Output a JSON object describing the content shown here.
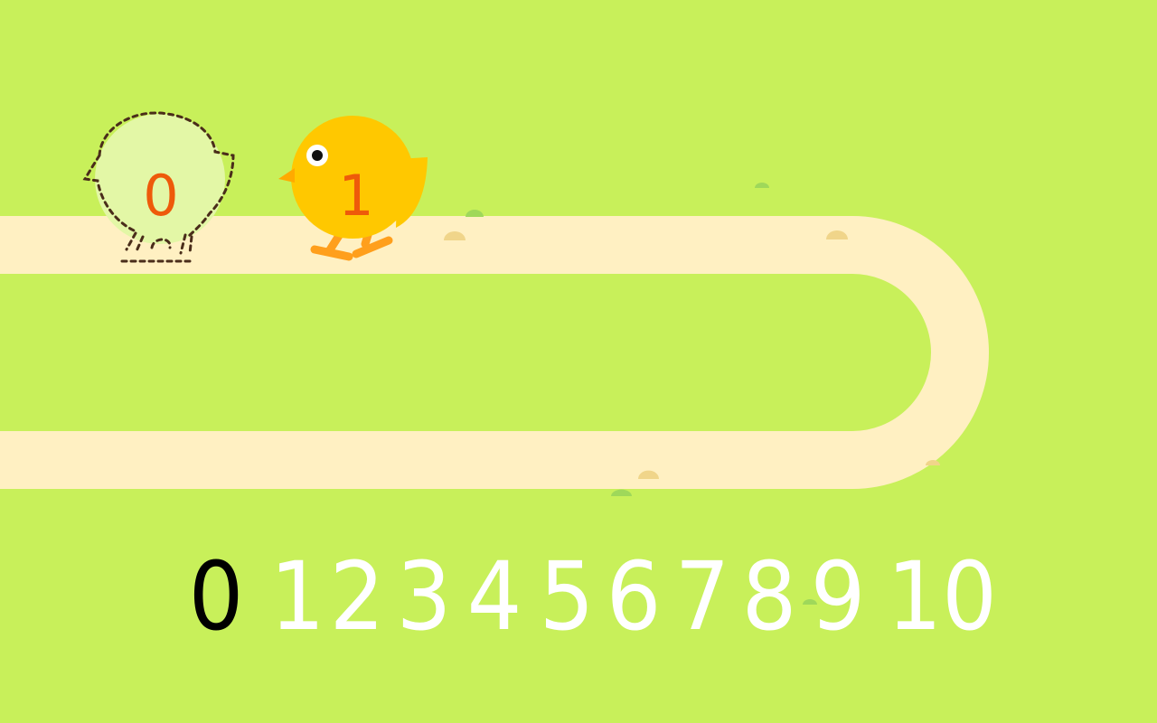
{
  "colors": {
    "background": "#c8f05a",
    "track": "#fff0c2",
    "chick_body": "#ffc800",
    "chick_beak": "#ffaa00",
    "chick_legs": "#ff9f1c",
    "chick_number": "#ee5a0a",
    "ghost_fill": "#e3f7a6",
    "ghost_outline": "#4a2d1a",
    "number_default": "#ffffff",
    "number_active": "#000000"
  },
  "ghost_chick": {
    "label": "0",
    "icon": "dashed-chick-outline"
  },
  "chick": {
    "label": "1",
    "icon": "yellow-chick"
  },
  "number_line": {
    "items": [
      "0",
      "1",
      "2",
      "3",
      "4",
      "5",
      "6",
      "7",
      "8",
      "9",
      "10"
    ],
    "active_index": 0
  }
}
